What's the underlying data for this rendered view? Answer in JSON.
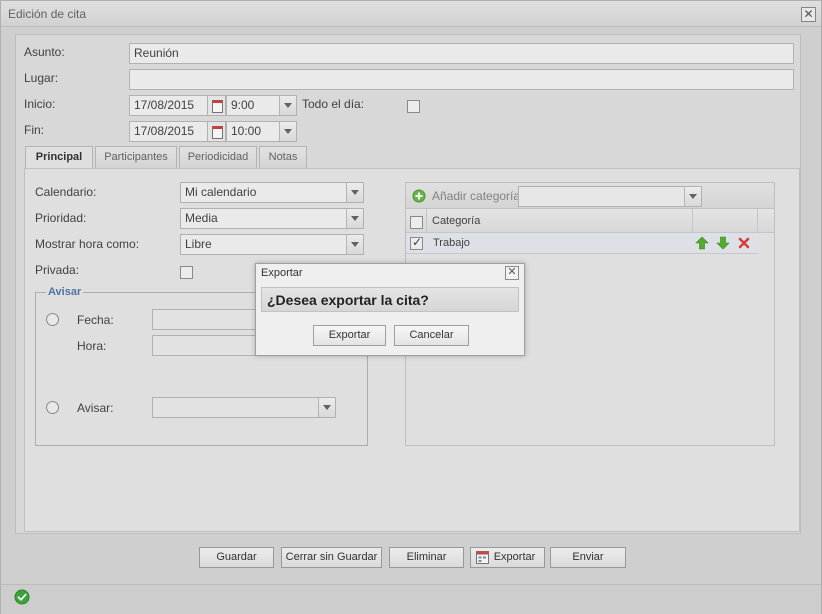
{
  "window": {
    "title": "Edición de cita",
    "close_glyph": "✕"
  },
  "header_form": {
    "subject_label": "Asunto:",
    "subject_value": "Reunión",
    "location_label": "Lugar:",
    "location_value": "",
    "start_label": "Inicio:",
    "start_date": "17/08/2015",
    "start_time": "9:00",
    "all_day_label": "Todo el día:",
    "all_day_checked": false,
    "end_label": "Fin:",
    "end_date": "17/08/2015",
    "end_time": "10:00"
  },
  "tabs": [
    {
      "label": "Principal",
      "active": true
    },
    {
      "label": "Participantes",
      "active": false
    },
    {
      "label": "Periodicidad",
      "active": false
    },
    {
      "label": "Notas",
      "active": false
    }
  ],
  "principal": {
    "calendar_label": "Calendario:",
    "calendar_value": "Mi calendario",
    "priority_label": "Prioridad:",
    "priority_value": "Media",
    "show_time_as_label": "Mostrar hora como:",
    "show_time_as_value": "Libre",
    "private_label": "Privada:",
    "private_checked": false,
    "reminder": {
      "legend": "Avisar",
      "date_label": "Fecha:",
      "date_value": "",
      "time_label": "Hora:",
      "time_value": "",
      "notify_label": "Avisar:",
      "notify_value": ""
    }
  },
  "categories": {
    "add_label": "Añadir categoría",
    "add_combo_value": "",
    "column_header": "Categoría",
    "rows": [
      {
        "name": "Trabajo",
        "checked": true
      }
    ]
  },
  "dialog": {
    "title": "Exportar",
    "message": "¿Desea exportar la cita?",
    "confirm_label": "Exportar",
    "cancel_label": "Cancelar"
  },
  "footer_buttons": {
    "save": "Guardar",
    "close_without_save": "Cerrar sin Guardar",
    "delete": "Eliminar",
    "export": "Exportar",
    "send": "Enviar"
  },
  "colors": {
    "accent_legend": "#5577aa",
    "up_arrow": "#4caf2a",
    "down_arrow": "#4caf2a",
    "delete_x": "#e04040",
    "status_ok": "#3faa3f"
  },
  "icons": {
    "status": "check-circle-icon",
    "add_category": "plus-circle-icon",
    "export": "export-icon"
  }
}
